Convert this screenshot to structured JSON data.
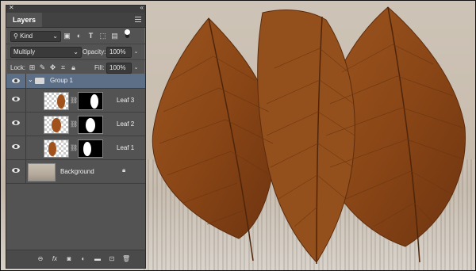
{
  "panel": {
    "tab_label": "Layers",
    "filter": {
      "kind_label": "Kind"
    },
    "blend_mode": "Multiply",
    "opacity_label": "Opacity:",
    "opacity_value": "100%",
    "lock_label": "Lock:",
    "fill_label": "Fill:",
    "fill_value": "100%"
  },
  "layers": [
    {
      "name": "Group 1",
      "type": "group",
      "selected": true
    },
    {
      "name": "Leaf 3",
      "type": "layer-with-mask"
    },
    {
      "name": "Leaf 2",
      "type": "layer-with-mask"
    },
    {
      "name": "Leaf 1",
      "type": "layer-with-mask"
    },
    {
      "name": "Background",
      "type": "background",
      "locked": true
    }
  ],
  "bottom_icons": [
    "link-layers-icon",
    "fx-icon",
    "add-mask-icon",
    "adjustment-icon",
    "new-group-icon",
    "new-layer-icon",
    "delete-icon"
  ],
  "icons": {
    "fx": "fx"
  },
  "colors": {
    "panel": "#535353",
    "selection": "#5d6f86",
    "leaf": "#8a4a1c"
  }
}
